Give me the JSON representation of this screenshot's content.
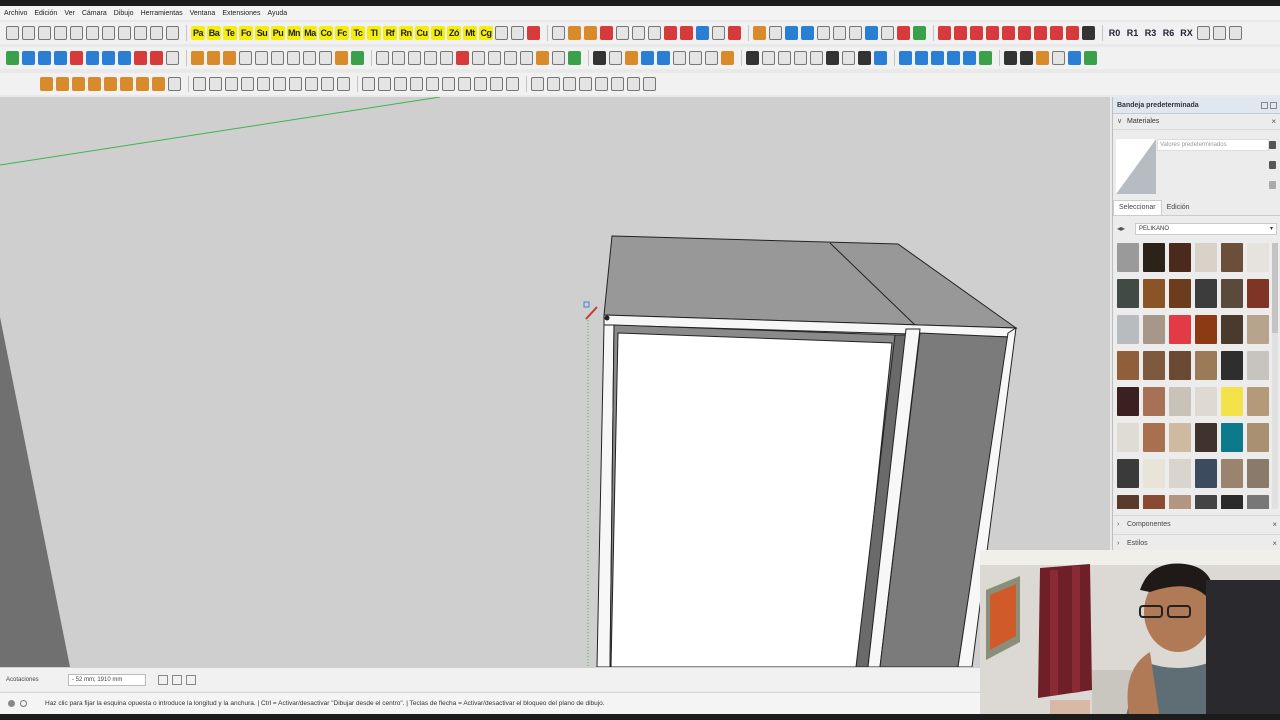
{
  "menu": [
    "Archivo",
    "Edición",
    "Ver",
    "Cámara",
    "Dibujo",
    "Herramientas",
    "Ventana",
    "Extensiones",
    "Ayuda"
  ],
  "toolbar_letters": [
    "Pa",
    "Ba",
    "Te",
    "Fo",
    "Su",
    "Pu",
    "Mn",
    "Ma",
    "Co",
    "Fc",
    "Tc",
    "Tl",
    "Rf",
    "Rn",
    "Cu",
    "Di",
    "Zó",
    "Mt",
    "Cg"
  ],
  "toolbar_right_text": [
    "R0",
    "R1",
    "R3",
    "R6",
    "RX"
  ],
  "tray": {
    "title": "Bandeja predeterminada",
    "materials_label": "Materiales",
    "material_name": "Valores predeterminados",
    "tab_select": "Seleccionar",
    "tab_edit": "Edición",
    "library": "PELIKANO",
    "swatch_colors": [
      "#9a9a9a",
      "#2b2219",
      "#4a2a1c",
      "#d8d2c9",
      "#6b4f3a",
      "#e6e3df",
      "#424a45",
      "#8a5426",
      "#6b3c1e",
      "#3c3c3c",
      "#5a4a3c",
      "#803524",
      "#b9bcbf",
      "#a6978a",
      "#e23b45",
      "#8c3a13",
      "#4a3a2e",
      "#b8a48c",
      "#8e5f3a",
      "#7d5a3e",
      "#6a4a33",
      "#9b7a58",
      "#2e2e2e",
      "#c7c4c0",
      "#3a2020",
      "#a87055",
      "#c9c2b8",
      "#dedad2",
      "#f4e24a",
      "#b49a78",
      "#dfdcd5",
      "#a8704e",
      "#cfb9a0",
      "#40332e",
      "#0c7a8a",
      "#a89070",
      "#3a3a3a",
      "#e8e4d8",
      "#d9d5cd",
      "#3c4c5e",
      "#9a8470",
      "#8a7a6a",
      "#5a3a2a",
      "#8a4a32",
      "#b49680",
      "#444444",
      "#2a2a2a",
      "#777777"
    ],
    "components_label": "Componentes",
    "styles_label": "Estilos"
  },
  "measurements": {
    "label": "Acotaciones",
    "value": "- 52 mm; 1910 mm"
  },
  "status": {
    "text": "Haz clic para fijar la esquina opuesta o introduce la longitud y la anchura. | Ctrl = Activar/desactivar \"Dibujar desde el centro\". | Teclas de flecha = Activar/desactivar el bloqueo del plano de dibujo."
  },
  "colors": {
    "viewport_bg": "#cfcfcf",
    "axis_green": "#3fb34f",
    "highlight_yellow": "#f4ee10"
  }
}
